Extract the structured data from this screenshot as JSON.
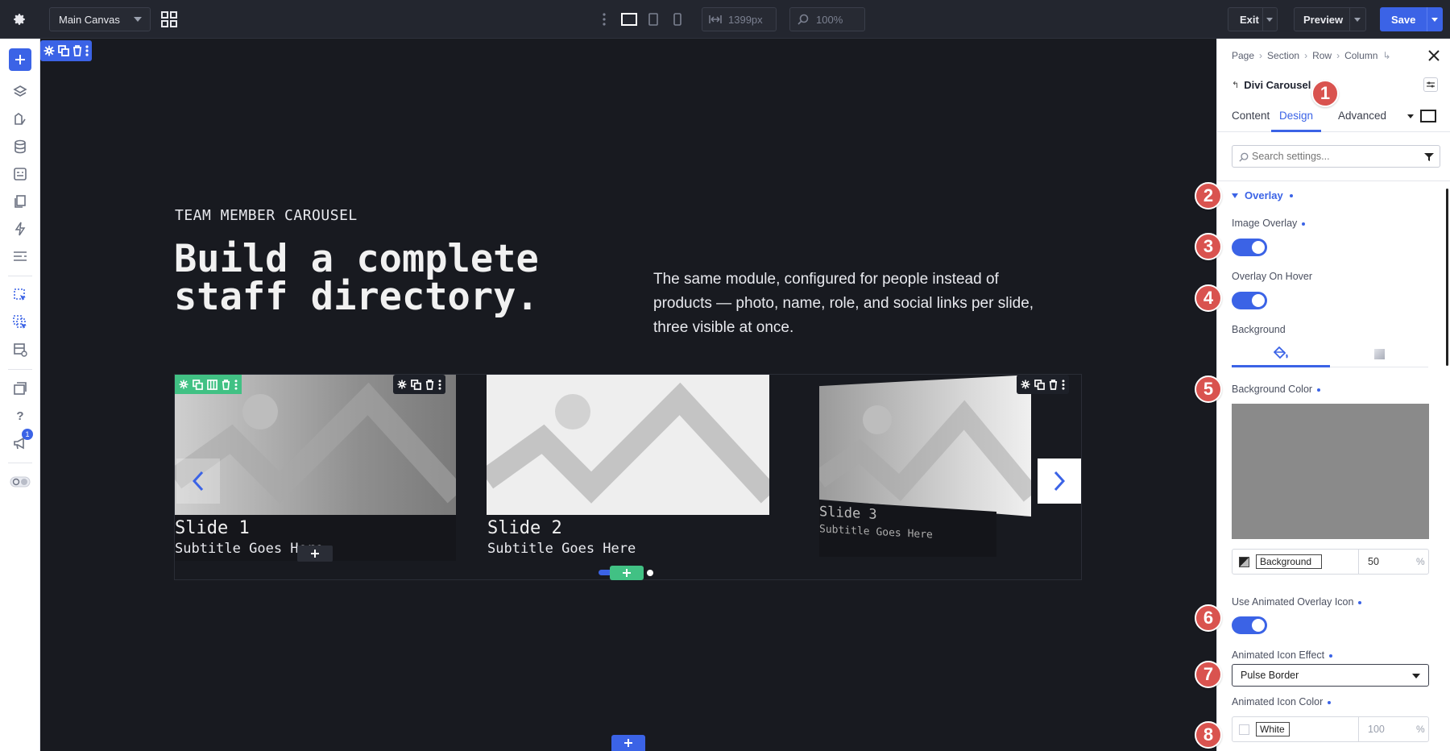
{
  "topbar": {
    "canvas_select": "Main Canvas",
    "width_value": "1399px",
    "zoom_value": "100%",
    "exit_label": "Exit",
    "preview_label": "Preview",
    "save_label": "Save"
  },
  "leftbar": {
    "notification_count": "1"
  },
  "canvas": {
    "eyebrow": "TEAM MEMBER CAROUSEL",
    "headline_line1": "Build a complete",
    "headline_line2": "staff directory.",
    "description": "The same module, configured for people instead of products — photo, name, role, and social links per slide, three visible at once.",
    "slides": [
      {
        "title": "Slide 1",
        "subtitle": "Subtitle Goes Here"
      },
      {
        "title": "Slide 2",
        "subtitle": "Subtitle Goes Here"
      },
      {
        "title": "Slide 3",
        "subtitle": "Subtitle Goes Here"
      }
    ]
  },
  "panel": {
    "breadcrumb": [
      "Page",
      "Section",
      "Row",
      "Column"
    ],
    "module_title": "Divi Carousel",
    "tabs": [
      "Content",
      "Design",
      "Advanced"
    ],
    "active_tab": "Design",
    "search_placeholder": "Search settings...",
    "section_title": "Overlay",
    "image_overlay_label": "Image Overlay",
    "overlay_on_hover_label": "Overlay On Hover",
    "background_label": "Background",
    "background_color_label": "Background Color",
    "background_color_swatch": "#8a8a8a",
    "bg_color_name": "Background",
    "bg_opacity": "50",
    "percent": "%",
    "use_animated_icon_label": "Use Animated Overlay Icon",
    "animated_effect_label": "Animated Icon Effect",
    "animated_effect_value": "Pulse Border",
    "animated_color_label": "Animated Icon Color",
    "animated_color_name": "White",
    "animated_color_opacity": "100"
  },
  "badges": [
    "1",
    "2",
    "3",
    "4",
    "5",
    "6",
    "7",
    "8"
  ],
  "colors": {
    "accent": "#3b63e6",
    "badge": "#d9534f",
    "green": "#41c184"
  }
}
